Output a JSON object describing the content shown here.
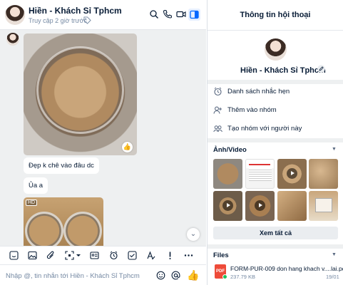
{
  "header": {
    "contact_name": "Hiền - Khách Sỉ Tphcm",
    "last_seen": "Truy cập 2 giờ trước",
    "icons": [
      "search-icon",
      "phone-icon",
      "video-call-icon",
      "sidebar-toggle-icon"
    ]
  },
  "messages": {
    "photo1_icon": "like-icon",
    "bubble1": "Đẹp k chê vào đâu dc",
    "bubble2": "Ủa a",
    "hd_badge": "HD",
    "scroll_icon": "chevron-down-icon"
  },
  "toolbar": {
    "icons": [
      "sticker-icon",
      "image-icon",
      "attachment-icon",
      "screenshot-icon",
      "contact-card-icon",
      "reminder-icon",
      "task-icon",
      "text-format-icon",
      "urgent-icon",
      "more-icon"
    ]
  },
  "composer": {
    "placeholder": "Nhập @, tin nhắn tới Hiền - Khách Sỉ Tphcm",
    "icons": [
      "emoji-icon",
      "mention-icon",
      "thumbs-up-icon"
    ]
  },
  "panel": {
    "title": "Thông tin hội thoại",
    "name": "Hiền - Khách Sỉ Tphcm",
    "actions": [
      {
        "label": "Danh sách nhắc hẹn",
        "icon": "alarm-clock-icon"
      },
      {
        "label": "Thêm vào nhóm",
        "icon": "add-to-group-icon"
      },
      {
        "label": "Tạo nhóm với người này",
        "icon": "create-group-icon"
      }
    ],
    "media_title": "Ảnh/Video",
    "see_all": "Xem tất cả",
    "files_title": "Files",
    "file": {
      "name": "FORM-PUR-009 don hang khach v....lai.pdf",
      "size": "237.79 KB",
      "date": "19/01",
      "type_label": "PDF"
    }
  },
  "colors": {
    "accent": "#0068ff",
    "text": "#081c36",
    "muted": "#7589a3",
    "chat_bg": "#eef0f1"
  }
}
